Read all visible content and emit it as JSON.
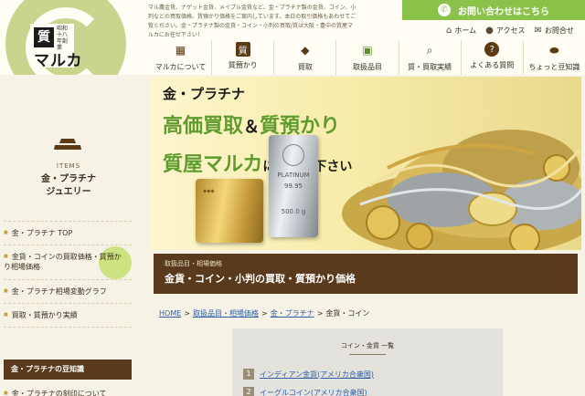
{
  "logo": {
    "shichi": "質",
    "maruka": "マルカ",
    "sub": "昭和十八年創業"
  },
  "intro": [
    "マル農金貨、ナゲット金貨、メイプル金貨など、金・プラチナ製の金貨、コイン、小",
    "判などの買取価格、質預かり価格をご案内しています。本日の取引価格もあわせてご",
    "覧ください。金・プラチナ製の金貨・コイン・小判の買取/質は大阪・豊中の質屋マ",
    "ルカにお任せ下さい！"
  ],
  "contact": {
    "label": "お問い合わせはこちら",
    "icon": "phone-icon"
  },
  "util_nav": [
    {
      "label": "ホーム",
      "icon": "home-icon",
      "glyph": "⌂"
    },
    {
      "label": "アクセス",
      "icon": "map-pin-icon",
      "glyph": "●"
    },
    {
      "label": "お問合せ",
      "icon": "mail-icon",
      "glyph": "✉"
    }
  ],
  "global_nav": [
    {
      "label": "マルカについて",
      "icon": "store-icon",
      "glyph": "▦",
      "active": false
    },
    {
      "label": "質預かり",
      "icon": "shichi-icon",
      "glyph": "質",
      "active": false
    },
    {
      "label": "買取",
      "icon": "diamond-icon",
      "glyph": "◆",
      "active": false
    },
    {
      "label": "取扱品目",
      "icon": "box-icon",
      "glyph": "▣",
      "active": true
    },
    {
      "label": "質・買取実績",
      "icon": "magnifier-icon",
      "glyph": "⌕",
      "active": false
    },
    {
      "label": "よくある質問",
      "icon": "question-icon",
      "glyph": "?",
      "active": false
    },
    {
      "label": "ちょっと豆知識",
      "icon": "bean-icon",
      "glyph": "⬬",
      "active": false
    }
  ],
  "sidebar": {
    "items_label": "ITEMS",
    "title_line1": "金・プラチナ",
    "title_line2": "ジュエリー",
    "links": [
      "金・プラチナ TOP",
      "金貨・コインの買取価格・質預かり相場価格",
      "金・プラチナ相場変動グラフ",
      "買取・質預かり実績"
    ],
    "section_head": "金・プラチナの豆知識",
    "last_link": "金・プラチナの刻印について"
  },
  "hero": {
    "line1": "金・プラチナ",
    "line2a": "高価買取",
    "amp": "＆",
    "line2b": "質預かり",
    "line3a": "質屋マルカ",
    "line3b": "にお任せ下さい",
    "plat_brand": "PLATINUM",
    "plat_purity": "99.95",
    "plat_weight": "500.0 g"
  },
  "ribbon": {
    "sub": "取扱品目・相場価格",
    "title": "金貨・コイン・小判の買取・質預かり価格"
  },
  "breadcrumb": {
    "home": "HOME",
    "items": "取扱品目・相場価格",
    "gold": "金・プラチナ",
    "current": "金貨・コイン",
    "sep": ">"
  },
  "coin_list": {
    "title": "コイン・金貨 一覧",
    "items": [
      {
        "num": "1",
        "label": "インディアン金貨(アメリカ合衆国)"
      },
      {
        "num": "2",
        "label": "イーグルコイン(アメリカ合衆国)"
      }
    ]
  },
  "colors": {
    "brown": "#5a3a1c",
    "green": "#8bc34a",
    "logo_green": "#c9d48f",
    "link": "#2d5fa8"
  }
}
